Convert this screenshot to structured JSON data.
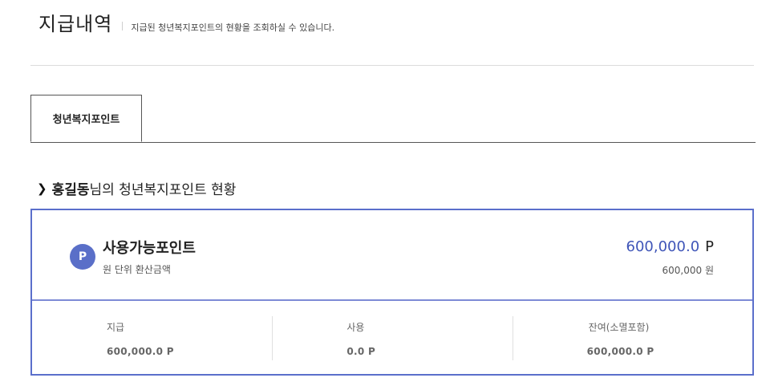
{
  "header": {
    "title": "지급내역",
    "description": "지급된 청년복지포인트의 현황을 조회하실 수 있습니다."
  },
  "tabs": [
    {
      "label": "청년복지포인트",
      "active": true
    }
  ],
  "section": {
    "user_name": "홍길동",
    "suffix": "님의 청년복지포인트 현황"
  },
  "summary": {
    "badge": "P",
    "label": "사용가능포인트",
    "sub_label": "원 단위 환산금액",
    "points": "600,000.0",
    "points_unit": "P",
    "won": "600,000 원"
  },
  "stats": [
    {
      "label": "지급",
      "value": "600,000.0  P"
    },
    {
      "label": "사용",
      "value": "0.0  P"
    },
    {
      "label": "잔여(소멸포함)",
      "value": "600,000.0  P"
    }
  ],
  "colors": {
    "accent": "#5a6fc8",
    "points_text": "#3f55b8"
  }
}
